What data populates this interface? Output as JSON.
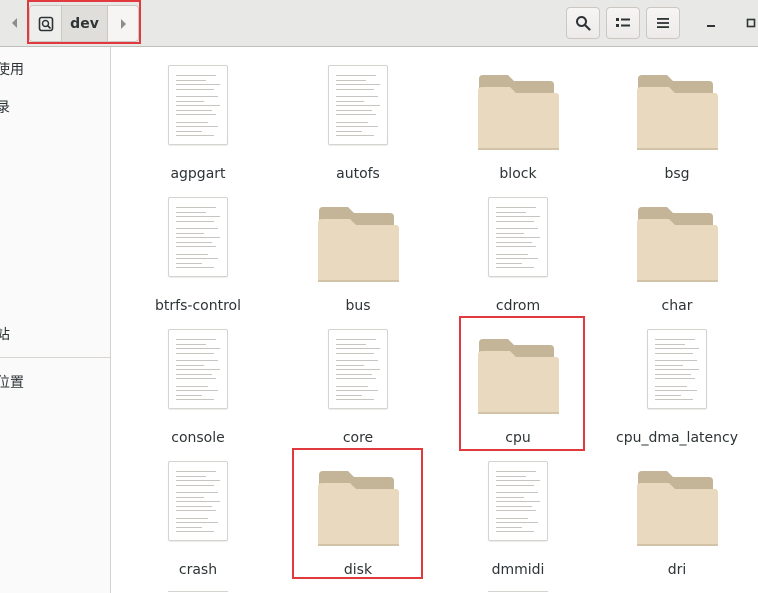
{
  "path": {
    "current": "dev"
  },
  "sidebar": {
    "items": [
      "使用",
      "录",
      "站",
      "位置"
    ]
  },
  "files": [
    {
      "name": "agpgart",
      "type": "file"
    },
    {
      "name": "autofs",
      "type": "file"
    },
    {
      "name": "block",
      "type": "folder"
    },
    {
      "name": "bsg",
      "type": "folder"
    },
    {
      "name": "btrfs-control",
      "type": "file"
    },
    {
      "name": "bus",
      "type": "folder"
    },
    {
      "name": "cdrom",
      "type": "file"
    },
    {
      "name": "char",
      "type": "folder"
    },
    {
      "name": "console",
      "type": "file"
    },
    {
      "name": "core",
      "type": "file"
    },
    {
      "name": "cpu",
      "type": "folder"
    },
    {
      "name": "cpu_dma_latency",
      "type": "file"
    },
    {
      "name": "crash",
      "type": "file"
    },
    {
      "name": "disk",
      "type": "folder"
    },
    {
      "name": "dmmidi",
      "type": "file"
    },
    {
      "name": "dri",
      "type": "folder"
    }
  ],
  "colors": {
    "highlight": "#e0393e",
    "folder_back": "#c4b498",
    "folder_front": "#e9d9bf"
  }
}
